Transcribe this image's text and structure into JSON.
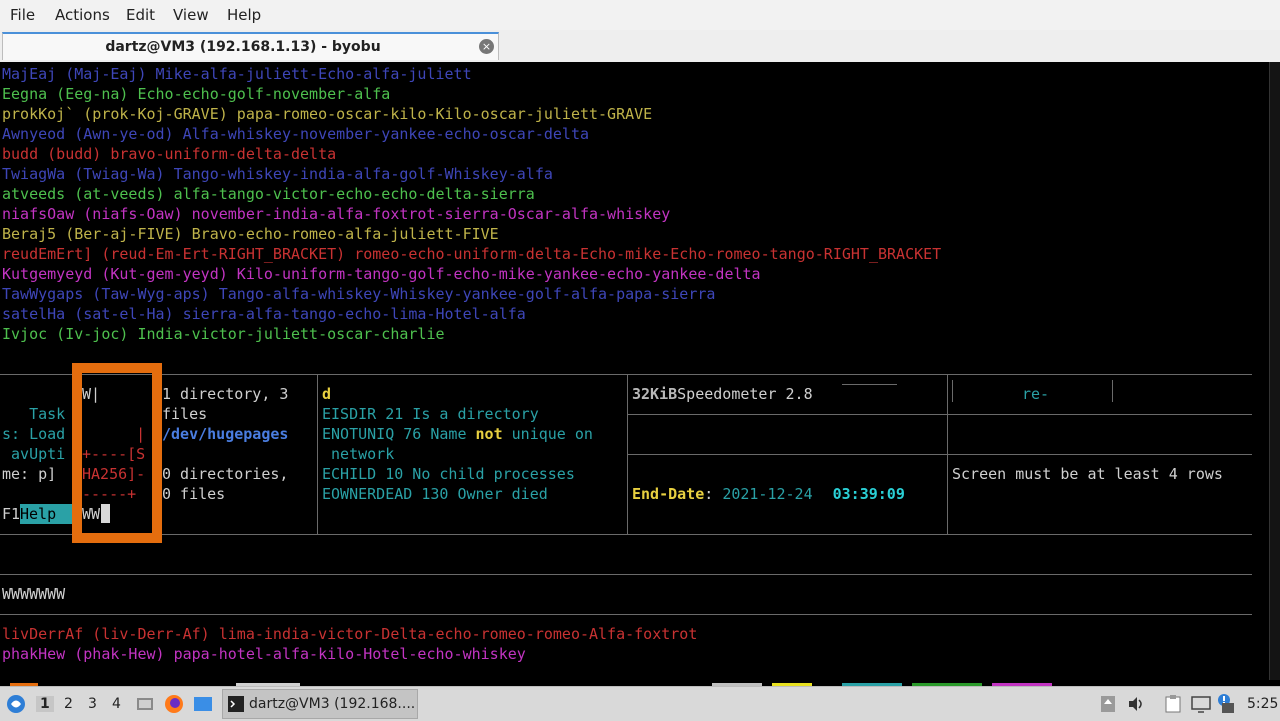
{
  "menubar": {
    "file": "File",
    "actions": "Actions",
    "edit": "Edit",
    "view": "View",
    "help": "Help"
  },
  "tab": {
    "title": "dartz@VM3 (192.168.1.13) - byobu",
    "close": "×"
  },
  "terminal": {
    "lines": [
      "MajEaj (Maj-Eaj) Mike-alfa-juliett-Echo-alfa-juliett",
      "Eegna (Eeg-na) Echo-echo-golf-november-alfa",
      "prokKoj` (prok-Koj-GRAVE) papa-romeo-oscar-kilo-Kilo-oscar-juliett-GRAVE",
      "Awnyeod (Awn-ye-od) Alfa-whiskey-november-yankee-echo-oscar-delta",
      "budd (budd) bravo-uniform-delta-delta",
      "TwiagWa (Twiag-Wa) Tango-whiskey-india-alfa-golf-Whiskey-alfa",
      "atveeds (at-veeds) alfa-tango-victor-echo-echo-delta-sierra",
      "niafsOaw (niafs-Oaw) november-india-alfa-foxtrot-sierra-Oscar-alfa-whiskey",
      "Beraj5 (Ber-aj-FIVE) Bravo-echo-romeo-alfa-juliett-FIVE",
      "reudEmErt] (reud-Em-Ert-RIGHT_BRACKET) romeo-echo-uniform-delta-Echo-mike-Echo-romeo-tango-RIGHT_BRACKET",
      "Kutgemyeyd (Kut-gem-yeyd) Kilo-uniform-tango-golf-echo-mike-yankee-echo-yankee-delta",
      "TawWygaps (Taw-Wyg-aps) Tango-alfa-whiskey-Whiskey-yankee-golf-alfa-papa-sierra",
      "satelHa (sat-el-Ha) sierra-alfa-tango-echo-lima-Hotel-alfa",
      "Ivjoc (Iv-joc) India-victor-juliett-oscar-charlie"
    ],
    "pane1": {
      "l1": "   Task",
      "l2": "s: Load",
      "l3": " avUpti",
      "l4": "me: p]",
      "f1": "F1",
      "help": "Help"
    },
    "pane2": {
      "l1": "W|",
      "l2": "      |",
      "l3": "+----[S",
      "l4": "HA256]-",
      "l5": "-----+",
      "l6": "WW"
    },
    "pane3": {
      "l1": "1 directory, 3",
      "l2": "files",
      "l3": "/dev/hugepages",
      "l4": "0 directories,",
      "l5": "0 files"
    },
    "pane4": {
      "l1": "d",
      "l2": "EISDIR 21 Is a directory",
      "l3a": "ENOTUNIQ 76 Name ",
      "l3b": "not",
      "l3c": " unique on",
      "l4": " network",
      "l5": "ECHILD 10 No child processes",
      "l6": "EOWNERDEAD 130 Owner died"
    },
    "pane5": {
      "size": "32KiB",
      "speed": "Speedometer 2.8",
      "end_label": "End-Date",
      "colon": ": ",
      "date": "2021-12-24",
      "time": "03:39:09"
    },
    "pane6": {
      "re": "re-",
      "msg": "Screen must be at least 4 rows"
    },
    "lower": "WWWWWWW",
    "bottom_lines": [
      "livDerrAf (liv-Derr-Af) lima-india-victor-Delta-echo-romeo-romeo-Alfa-foxtrot",
      "phakHew (phak-Hew) papa-hotel-alfa-kilo-Hotel-echo-whiskey"
    ]
  },
  "taskbar": {
    "workspaces": [
      "1",
      "2",
      "3",
      "4"
    ],
    "task_label": "dartz@VM3 (192.168....",
    "clock": "5:25",
    "icons": [
      "start-menu-icon",
      "show-desktop-icon",
      "firefox-icon",
      "files-icon",
      "terminal-icon",
      "upload-icon",
      "volume-icon",
      "clipboard-icon",
      "screen-icon",
      "update-icon",
      "power-icon"
    ]
  },
  "colors": {
    "accent": "#e46d0e",
    "help_bg": "#2aa1a6",
    "terminal_bg": "#000000"
  }
}
